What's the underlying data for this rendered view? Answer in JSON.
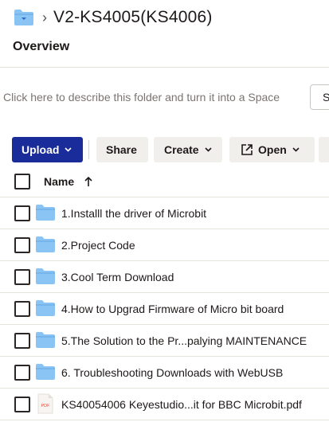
{
  "breadcrumb": {
    "folder_icon": "folder-icon",
    "separator": "›",
    "title": "V2-KS4005(KS4006)"
  },
  "overview": {
    "label": "Overview"
  },
  "description": {
    "placeholder": "Click here to describe this folder and turn it into a Space",
    "side_button": "S"
  },
  "toolbar": {
    "upload": "Upload",
    "share": "Share",
    "create": "Create",
    "open": "Open"
  },
  "table": {
    "column_name": "Name",
    "sort_icon": "arrow-up-icon",
    "rows": [
      {
        "label": "1.Installl the driver of Microbit",
        "type": "folder"
      },
      {
        "label": "2.Project Code",
        "type": "folder"
      },
      {
        "label": "3.Cool Term Download",
        "type": "folder"
      },
      {
        "label": "4.How to Upgrad Firmware of Micro bit board",
        "type": "folder"
      },
      {
        "label": "5.The Solution to the Pr...palying MAINTENANCE",
        "type": "folder"
      },
      {
        "label": "6. Troubleshooting Downloads with WebUSB",
        "type": "folder"
      },
      {
        "label": "KS40054006 Keyestudio...it for BBC Microbit.pdf",
        "type": "pdf",
        "badge": "PDF"
      }
    ]
  },
  "colors": {
    "folder": "#8ac4f4",
    "folder_dark": "#64a6e6",
    "upload_bg": "#1a2c9a",
    "pdf_red": "#e8463d"
  }
}
